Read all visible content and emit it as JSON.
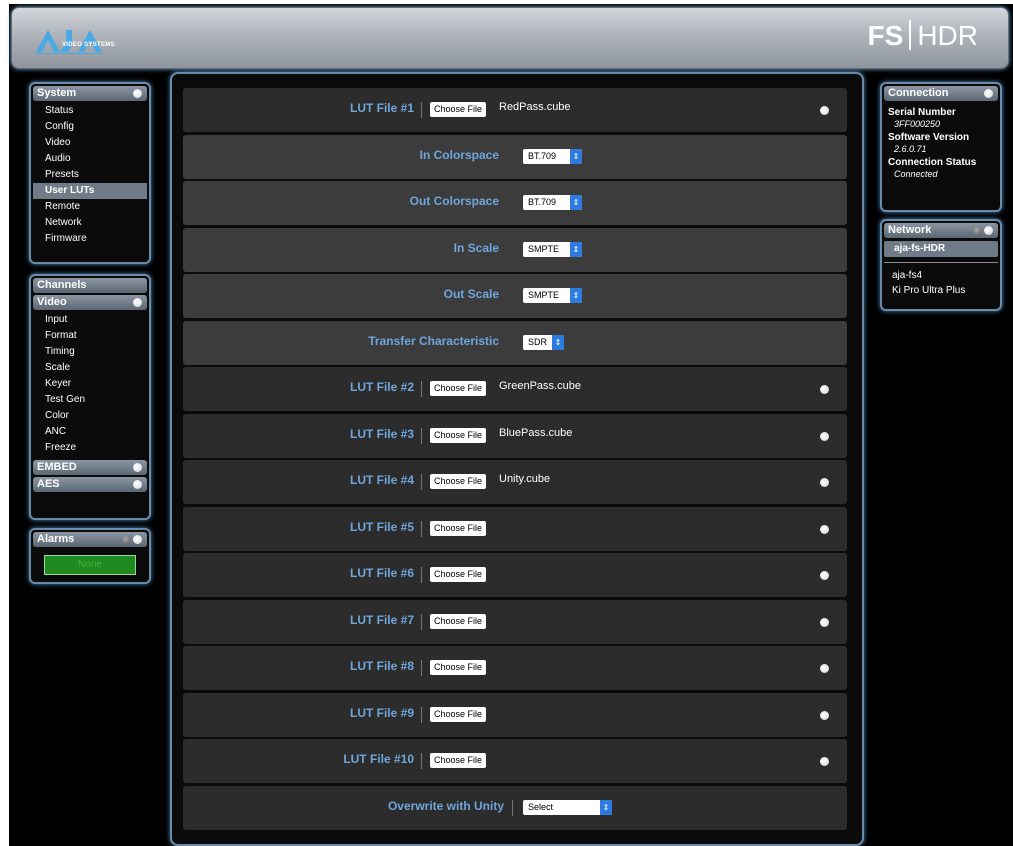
{
  "header": {
    "logo_text": "AJA",
    "logo_sub": "VIDEO SYSTEMS",
    "product_fs": "FS",
    "product_hdr": "HDR"
  },
  "system_panel": {
    "title": "System",
    "items": [
      {
        "label": "Status"
      },
      {
        "label": "Config"
      },
      {
        "label": "Video"
      },
      {
        "label": "Audio"
      },
      {
        "label": "Presets"
      },
      {
        "label": "User LUTs",
        "active": true
      },
      {
        "label": "Remote"
      },
      {
        "label": "Network"
      },
      {
        "label": "Firmware"
      }
    ]
  },
  "channels_panel": {
    "title": "Channels",
    "video_title": "Video",
    "video_items": [
      {
        "label": "Input"
      },
      {
        "label": "Format"
      },
      {
        "label": "Timing"
      },
      {
        "label": "Scale"
      },
      {
        "label": "Keyer"
      },
      {
        "label": "Test Gen"
      },
      {
        "label": "Color"
      },
      {
        "label": "ANC"
      },
      {
        "label": "Freeze"
      }
    ],
    "embed_title": "EMBED",
    "aes_title": "AES"
  },
  "alarms_panel": {
    "title": "Alarms",
    "status": "None"
  },
  "main": {
    "choose_label": "Choose File",
    "lut_files": [
      {
        "label": "LUT File #1",
        "file": "RedPass.cube"
      },
      {
        "label": "LUT File #2",
        "file": "GreenPass.cube"
      },
      {
        "label": "LUT File #3",
        "file": "BluePass.cube"
      },
      {
        "label": "LUT File #4",
        "file": "Unity.cube"
      },
      {
        "label": "LUT File #5",
        "file": ""
      },
      {
        "label": "LUT File #6",
        "file": ""
      },
      {
        "label": "LUT File #7",
        "file": ""
      },
      {
        "label": "LUT File #8",
        "file": ""
      },
      {
        "label": "LUT File #9",
        "file": ""
      },
      {
        "label": "LUT File #10",
        "file": ""
      }
    ],
    "lut1_settings": [
      {
        "label": "In Colorspace",
        "value": "BT.709"
      },
      {
        "label": "Out Colorspace",
        "value": "BT.709"
      },
      {
        "label": "In Scale",
        "value": "SMPTE"
      },
      {
        "label": "Out Scale",
        "value": "SMPTE"
      },
      {
        "label": "Transfer Characteristic",
        "value": "SDR"
      }
    ],
    "overwrite": {
      "label": "Overwrite with Unity",
      "value": "Select"
    }
  },
  "connection_panel": {
    "title": "Connection",
    "serial_label": "Serial Number",
    "serial_value": "3FF000250",
    "software_label": "Software Version",
    "software_value": "2.6.0.71",
    "status_label": "Connection Status",
    "status_value": "Connected"
  },
  "network_panel": {
    "title": "Network",
    "selected": "aja-fs-HDR",
    "items": [
      {
        "label": "aja-fs4"
      },
      {
        "label": "Ki Pro Ultra Plus"
      }
    ]
  },
  "colors": {
    "accent_blue": "#6fa6dc",
    "panel_border": "#6a8caa",
    "select_arrow": "#2e7be0",
    "alarm_green": "#1f8a1f"
  }
}
